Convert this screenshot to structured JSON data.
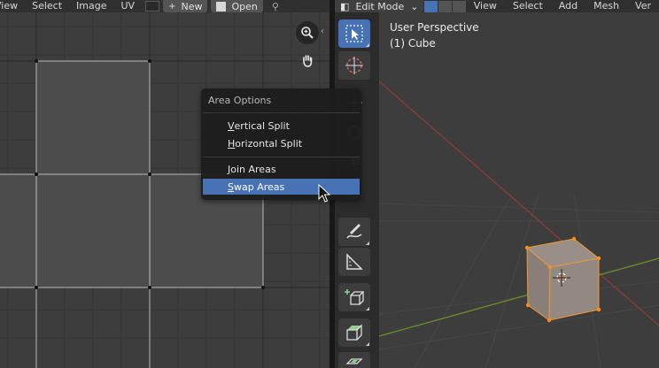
{
  "uv_header": {
    "view_label": "View",
    "select_label": "Select",
    "image_label": "Image",
    "uv_label": "UV",
    "new_label": "New",
    "open_label": "Open"
  },
  "viewport_header": {
    "mode": "Edit Mode",
    "view_label": "View",
    "select_label": "Select",
    "add_label": "Add",
    "mesh_label": "Mesh",
    "vertex_label": "Ver"
  },
  "viewport": {
    "perspective": "User Perspective",
    "object": "(1) Cube"
  },
  "area_options": {
    "title": "Area Options",
    "items": [
      {
        "first": "V",
        "rest": "ertical Split"
      },
      {
        "first": "H",
        "rest": "orizontal Split"
      },
      {
        "first": "J",
        "rest": "oin Areas"
      },
      {
        "first": "S",
        "rest": "wap Areas"
      }
    ]
  },
  "colors": {
    "accent": "#4772b3",
    "background": "#3d3d3d",
    "grid_line": "#343434",
    "x_axis": "#8b3a3a",
    "y_axis": "#6a8a2a",
    "cube_face": "#8a8079",
    "vertex_selected": "#ff8c1a"
  },
  "icons": {
    "zoom_tool": "zoom-in-icon",
    "pan_tool": "hand-icon",
    "select_tool": "select-box-icon",
    "cursor_tool": "cursor-3d-icon",
    "annotate_tool": "annotate-icon",
    "measure_tool": "measure-icon",
    "add_cube_tool": "add-cube-icon",
    "extrude_tool": "extrude-icon",
    "inset_tool": "inset-icon"
  }
}
